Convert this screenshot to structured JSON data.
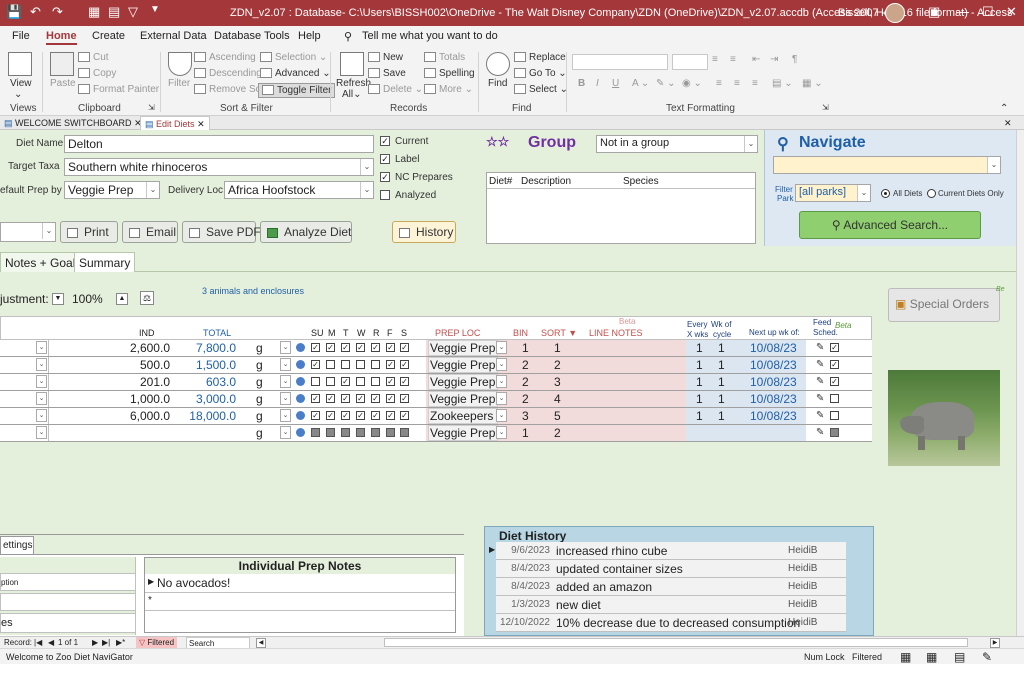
{
  "window": {
    "title": "ZDN_v2.07 : Database- C:\\Users\\BISSH002\\OneDrive - The Walt Disney Company\\ZDN (OneDrive)\\ZDN_v2.07.accdb (Access 2007 - 2016 file format) - Access",
    "user": "Bissell, Heidi"
  },
  "menu": [
    "File",
    "Home",
    "Create",
    "External Data",
    "Database Tools",
    "Help"
  ],
  "menu_active": "Home",
  "tell_me": "Tell me what you want to do",
  "ribbon": {
    "views": {
      "view": "View",
      "label": "Views"
    },
    "clipboard": {
      "paste": "Paste",
      "cut": "Cut",
      "copy": "Copy",
      "format_painter": "Format Painter",
      "label": "Clipboard"
    },
    "sort_filter": {
      "filter": "Filter",
      "ascending": "Ascending",
      "descending": "Descending",
      "remove_sort": "Remove Sort",
      "selection": "Selection",
      "advanced": "Advanced",
      "toggle_filter": "Toggle Filter",
      "label": "Sort & Filter"
    },
    "records": {
      "refresh": "Refresh",
      "refresh_all": "All",
      "new": "New",
      "save": "Save",
      "delete": "Delete",
      "totals": "Totals",
      "spelling": "Spelling",
      "more": "More",
      "label": "Records"
    },
    "find": {
      "find": "Find",
      "replace": "Replace",
      "go_to": "Go To",
      "select": "Select",
      "label": "Find"
    },
    "text_formatting": {
      "bold": "B",
      "italic": "I",
      "underline": "U",
      "label": "Text Formatting"
    }
  },
  "doc_tabs": [
    {
      "label": "WELCOME SWITCHBOARD",
      "active": false
    },
    {
      "label": "Edit Diets",
      "active": true
    }
  ],
  "form": {
    "diet_name_label": "Diet Name",
    "diet_name": "Delton",
    "target_taxa_label": "Target Taxa",
    "target_taxa": "Southern white rhinoceros",
    "default_prep_label": "efault Prep by",
    "default_prep": "Veggie Prep",
    "delivery_loc_label": "Delivery Loc",
    "delivery_loc": "Africa Hoofstock",
    "checks": [
      {
        "label": "Current",
        "checked": true
      },
      {
        "label": "Label",
        "checked": true
      },
      {
        "label": "NC Prepares",
        "checked": true
      },
      {
        "label": "Analyzed",
        "checked": false
      }
    ],
    "buttons": {
      "print": "Print",
      "email": "Email",
      "save_pdf": "Save PDF",
      "analyze": "Analyze Diet",
      "history": "History"
    },
    "group_title": "Group",
    "group_value": "Not in a group",
    "group_cols": [
      "Diet#",
      "Description",
      "Species"
    ]
  },
  "navigate": {
    "title": "Navigate",
    "filter_label_1": "Filter",
    "filter_label_2": "Park",
    "park": "[all parks]",
    "radio_all": "All Diets",
    "radio_current": "Current Diets Only",
    "advanced_search": "Advanced Search..."
  },
  "form_tabs": [
    {
      "label": "Notes + Goals",
      "active": false
    },
    {
      "label": "Summary",
      "active": true
    }
  ],
  "adjustment": {
    "label": "justment:",
    "value": "100%"
  },
  "animals_note": "3 animals and enclosures",
  "special_orders": "Special Orders",
  "beta_small": "Be",
  "grid": {
    "headers": {
      "ind": "IND",
      "total": "TOTAL",
      "days": [
        "SU",
        "M",
        "T",
        "W",
        "R",
        "F",
        "S"
      ],
      "prep_loc": "PREP LOC",
      "bin": "BIN",
      "sort": "SORT",
      "line_notes": "LINE NOTES",
      "beta": "Beta",
      "every_1": "Every",
      "every_2": "X wks",
      "wk_1": "Wk of",
      "wk_2": "cycle",
      "next_up": "Next up wk of:",
      "feed_1": "Feed",
      "feed_2": "Sched.",
      "feed_beta": "Beta"
    },
    "rows": [
      {
        "ind": "2,600.0",
        "total": "7,800.0",
        "unit": "g",
        "days": [
          1,
          1,
          1,
          1,
          1,
          1,
          1
        ],
        "prep": "Veggie Prep",
        "bin": "1",
        "sort": "1",
        "every": "1",
        "wk": "1",
        "next": "10/08/23",
        "feed": true
      },
      {
        "ind": "500.0",
        "total": "1,500.0",
        "unit": "g",
        "days": [
          1,
          0,
          0,
          0,
          0,
          1,
          1
        ],
        "prep": "Veggie Prep",
        "bin": "2",
        "sort": "2",
        "every": "1",
        "wk": "1",
        "next": "10/08/23",
        "feed": true
      },
      {
        "ind": "201.0",
        "total": "603.0",
        "unit": "g",
        "days": [
          0,
          0,
          1,
          0,
          0,
          1,
          1
        ],
        "prep": "Veggie Prep",
        "bin": "2",
        "sort": "3",
        "every": "1",
        "wk": "1",
        "next": "10/08/23",
        "feed": true
      },
      {
        "ind": "1,000.0",
        "total": "3,000.0",
        "unit": "g",
        "days": [
          1,
          1,
          1,
          1,
          1,
          1,
          1
        ],
        "prep": "Veggie Prep",
        "bin": "2",
        "sort": "4",
        "every": "1",
        "wk": "1",
        "next": "10/08/23",
        "feed": false
      },
      {
        "ind": "6,000.0",
        "total": "18,000.0",
        "unit": "g",
        "days": [
          1,
          1,
          1,
          1,
          1,
          1,
          1
        ],
        "prep": "Zookeepers",
        "bin": "3",
        "sort": "5",
        "every": "1",
        "wk": "1",
        "next": "10/08/23",
        "feed": false
      },
      {
        "ind": "",
        "total": "",
        "unit": "g",
        "days": [
          2,
          2,
          2,
          2,
          2,
          2,
          2
        ],
        "prep": "Veggie Prep",
        "bin": "1",
        "sort": "2",
        "every": "",
        "wk": "",
        "next": "",
        "feed": false,
        "new_row": true
      }
    ]
  },
  "lower": {
    "settings_tab": "ettings",
    "left_labels": [
      "ption",
      "es"
    ],
    "prep_notes_title": "Individual Prep Notes",
    "prep_notes": [
      "No avocados!"
    ],
    "history_title": "Diet History",
    "history": [
      {
        "date": "9/6/2023",
        "text": "increased rhino cube",
        "user": "HeidiB"
      },
      {
        "date": "8/4/2023",
        "text": "updated container sizes",
        "user": "HeidiB"
      },
      {
        "date": "8/4/2023",
        "text": "added an amazon",
        "user": "HeidiB"
      },
      {
        "date": "1/3/2023",
        "text": "new diet",
        "user": "HeidiB"
      },
      {
        "date": "12/10/2022",
        "text": "10% decrease due to decreased consumption",
        "user": "HeidiB"
      }
    ]
  },
  "record_nav": {
    "record_label": "Record:",
    "position": "1 of 1",
    "filtered": "Filtered",
    "search": "Search"
  },
  "status": {
    "message": "Welcome to Zoo Diet NaviGator",
    "num_lock": "Num Lock",
    "filtered": "Filtered"
  }
}
